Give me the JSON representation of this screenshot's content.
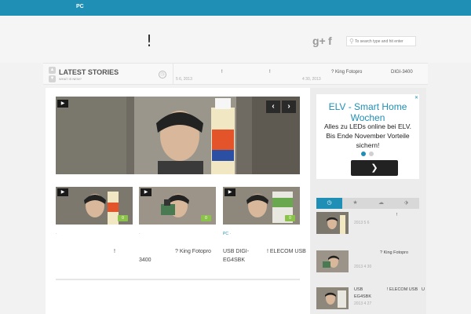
{
  "topbar": {
    "nav": "PC"
  },
  "header": {
    "site_title": "!",
    "gplus": "g+",
    "facebook": "f",
    "search_placeholder": "To search type and hit enter"
  },
  "ticker": {
    "label": "LATEST STORIES",
    "sub": "WHAT IS NEW?",
    "items": [
      "!",
      "!",
      "? King Fotopro",
      "DIGI-3400"
    ],
    "dates": [
      "5  6, 2013",
      "4  30, 2013"
    ]
  },
  "slider": {
    "play": "▶",
    "prev": "‹",
    "next": "›"
  },
  "thumbs": [
    {
      "play": "▶",
      "count": "0",
      "cat": "",
      "cat_pc": "",
      "title_lines": [
        "!"
      ]
    },
    {
      "play": "▶",
      "count": "0",
      "cat": "",
      "cat_pc": "",
      "title_lines": [
        "? King Fotopro",
        "3400"
      ]
    },
    {
      "play": "▶",
      "count": "0",
      "cat": "",
      "cat_pc": "PC",
      "title_lines": [
        "USB  DIGI-",
        "EG4SBK",
        "! ELECOM USB"
      ]
    }
  ],
  "ad": {
    "title": "ELV - Smart Home Wochen",
    "body": "Alles zu LEDs online bei ELV. Bis Ende November Vorteile sichern!",
    "next": "❯",
    "close": "✕"
  },
  "colors": {
    "accent": "#1f8fb5",
    "badge_green": "#8bc34a"
  },
  "sidebar_tabs": [
    "clock-icon",
    "star-icon",
    "comment-icon",
    "tag-icon"
  ],
  "sidebar_posts": [
    {
      "title": "!",
      "date": "2013  5  6"
    },
    {
      "title": "? King Fotopro",
      "date": "2013  4  30"
    },
    {
      "title_a": "USB",
      "title_b": "! ELECOM USB",
      "title_c": "U",
      "title_d": "EG4SBK",
      "date": "2013  4  27"
    }
  ]
}
